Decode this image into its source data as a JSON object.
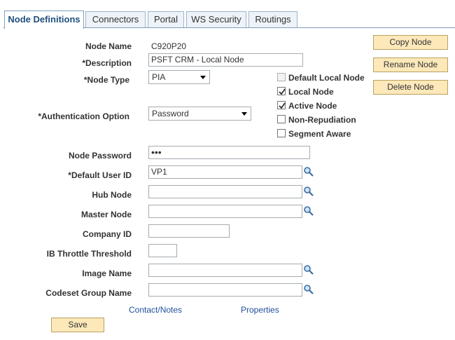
{
  "tabs": [
    {
      "label": "Node Definitions"
    },
    {
      "label": "Connectors"
    },
    {
      "label": "Portal"
    },
    {
      "label": "WS Security"
    },
    {
      "label": "Routings"
    }
  ],
  "form": {
    "node_name_label": "Node Name",
    "node_name_value": "C920P20",
    "description_label": "*Description",
    "description_value": "PSFT CRM - Local Node",
    "node_type_label": "*Node Type",
    "node_type_value": "PIA",
    "auth_label": "*Authentication Option",
    "auth_value": "Password",
    "node_password_label": "Node Password",
    "node_password_value": "•••",
    "default_user_label": "*Default User ID",
    "default_user_value": "VP1",
    "hub_node_label": "Hub Node",
    "hub_node_value": "",
    "master_node_label": "Master Node",
    "master_node_value": "",
    "company_id_label": "Company ID",
    "company_id_value": "",
    "throttle_label": "IB Throttle Threshold",
    "throttle_value": "",
    "image_name_label": "Image Name",
    "image_name_value": "",
    "codeset_label": "Codeset Group Name",
    "codeset_value": ""
  },
  "checkboxes": [
    {
      "label": "Default Local Node",
      "checked": false,
      "disabled": true
    },
    {
      "label": "Local Node",
      "checked": true,
      "disabled": false
    },
    {
      "label": "Active Node",
      "checked": true,
      "disabled": false
    },
    {
      "label": "Non-Repudiation",
      "checked": false,
      "disabled": false
    },
    {
      "label": "Segment Aware",
      "checked": false,
      "disabled": false
    }
  ],
  "buttons": {
    "copy": "Copy Node",
    "rename": "Rename Node",
    "delete": "Delete Node",
    "save": "Save"
  },
  "links": {
    "contact_notes": "Contact/Notes",
    "properties": "Properties"
  }
}
